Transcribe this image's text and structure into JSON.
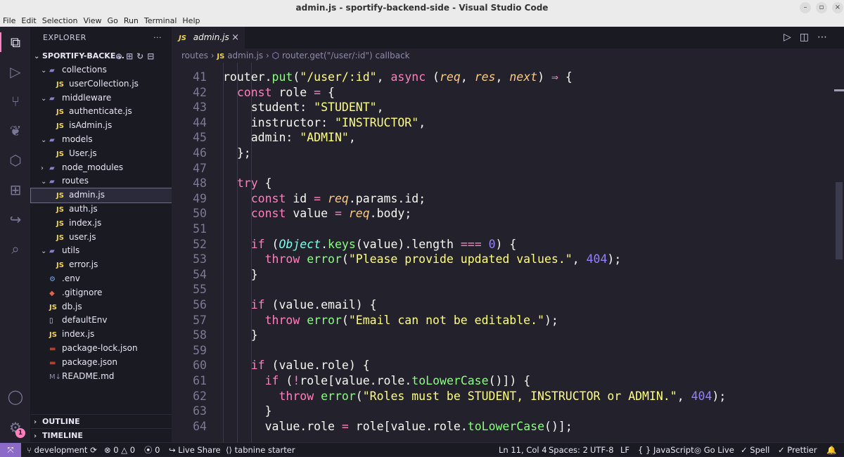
{
  "window": {
    "title": "admin.js - sportify-backend-side - Visual Studio Code"
  },
  "menu": [
    "File",
    "Edit",
    "Selection",
    "View",
    "Go",
    "Run",
    "Terminal",
    "Help"
  ],
  "sidebar": {
    "header": "EXPLORER",
    "more": "···",
    "root": "SPORTIFY-BACKE...",
    "tree": [
      {
        "label": "collections",
        "type": "folder",
        "depth": 1
      },
      {
        "label": "userCollection.js",
        "type": "js",
        "depth": 2
      },
      {
        "label": "middleware",
        "type": "folder",
        "depth": 1
      },
      {
        "label": "authenticate.js",
        "type": "js",
        "depth": 2
      },
      {
        "label": "isAdmin.js",
        "type": "js",
        "depth": 2
      },
      {
        "label": "models",
        "type": "folder",
        "depth": 1
      },
      {
        "label": "User.js",
        "type": "js",
        "depth": 2
      },
      {
        "label": "node_modules",
        "type": "folder-closed",
        "depth": 1
      },
      {
        "label": "routes",
        "type": "folder",
        "depth": 1
      },
      {
        "label": "admin.js",
        "type": "js",
        "depth": 2,
        "selected": true
      },
      {
        "label": "auth.js",
        "type": "js",
        "depth": 2
      },
      {
        "label": "index.js",
        "type": "js",
        "depth": 2
      },
      {
        "label": "user.js",
        "type": "js",
        "depth": 2
      },
      {
        "label": "utils",
        "type": "folder",
        "depth": 1
      },
      {
        "label": "error.js",
        "type": "js",
        "depth": 2
      },
      {
        "label": ".env",
        "type": "gear",
        "depth": 1
      },
      {
        "label": ".gitignore",
        "type": "git",
        "depth": 1
      },
      {
        "label": "db.js",
        "type": "js",
        "depth": 1
      },
      {
        "label": "defaultEnv",
        "type": "file",
        "depth": 1
      },
      {
        "label": "index.js",
        "type": "js",
        "depth": 1
      },
      {
        "label": "package-lock.json",
        "type": "npm",
        "depth": 1
      },
      {
        "label": "package.json",
        "type": "npm",
        "depth": 1
      },
      {
        "label": "README.md",
        "type": "md",
        "depth": 1
      }
    ],
    "outline": "OUTLINE",
    "timeline": "TIMELINE"
  },
  "tab": {
    "label": "admin.js",
    "icon": "JS"
  },
  "breadcrumb": {
    "folder": "routes",
    "file": "admin.js",
    "symbol": "router.get(\"/user/:id\") callback"
  },
  "editor": {
    "lines": [
      {
        "n": "41",
        "text": "router.put(\"/user/:id\", async (req, res, next) ⇒ {"
      },
      {
        "n": "42",
        "text": "  const role = {"
      },
      {
        "n": "43",
        "text": "    student: \"STUDENT\","
      },
      {
        "n": "44",
        "text": "    instructor: \"INSTRUCTOR\","
      },
      {
        "n": "45",
        "text": "    admin: \"ADMIN\","
      },
      {
        "n": "46",
        "text": "  };"
      },
      {
        "n": "47",
        "text": ""
      },
      {
        "n": "48",
        "text": "  try {"
      },
      {
        "n": "49",
        "text": "    const id = req.params.id;"
      },
      {
        "n": "50",
        "text": "    const value = req.body;"
      },
      {
        "n": "51",
        "text": ""
      },
      {
        "n": "52",
        "text": "    if (Object.keys(value).length === 0) {"
      },
      {
        "n": "53",
        "text": "      throw error(\"Please provide updated values.\", 404);"
      },
      {
        "n": "54",
        "text": "    }"
      },
      {
        "n": "55",
        "text": ""
      },
      {
        "n": "56",
        "text": "    if (value.email) {"
      },
      {
        "n": "57",
        "text": "      throw error(\"Email can not be editable.\");"
      },
      {
        "n": "58",
        "text": "    }"
      },
      {
        "n": "59",
        "text": ""
      },
      {
        "n": "60",
        "text": "    if (value.role) {"
      },
      {
        "n": "61",
        "text": "      if (!role[value.role.toLowerCase()]) {"
      },
      {
        "n": "62",
        "text": "        throw error(\"Roles must be STUDENT, INSTRUCTOR or ADMIN.\", 404);"
      },
      {
        "n": "63",
        "text": "      }"
      },
      {
        "n": "64",
        "text": "      value.role = role[value.role.toLowerCase()];"
      }
    ]
  },
  "status": {
    "branch": "development",
    "errors": "0",
    "warnings": "0",
    "ports": "0",
    "live_share": "Live Share",
    "tabnine": "tabnine starter",
    "position": "Ln 11, Col 4",
    "spaces": "Spaces: 2",
    "encoding": "UTF-8",
    "eol": "LF",
    "language": "JavaScript",
    "go_live": "Go Live",
    "spell": "Spell",
    "prettier": "Prettier"
  },
  "badges": {
    "settings": "1"
  },
  "colors": {
    "background": "#22212c",
    "sidebar": "#1a1a23",
    "accent": "#ff80bf",
    "string": "#ffff80",
    "function": "#8aff80",
    "number": "#9580ff"
  }
}
